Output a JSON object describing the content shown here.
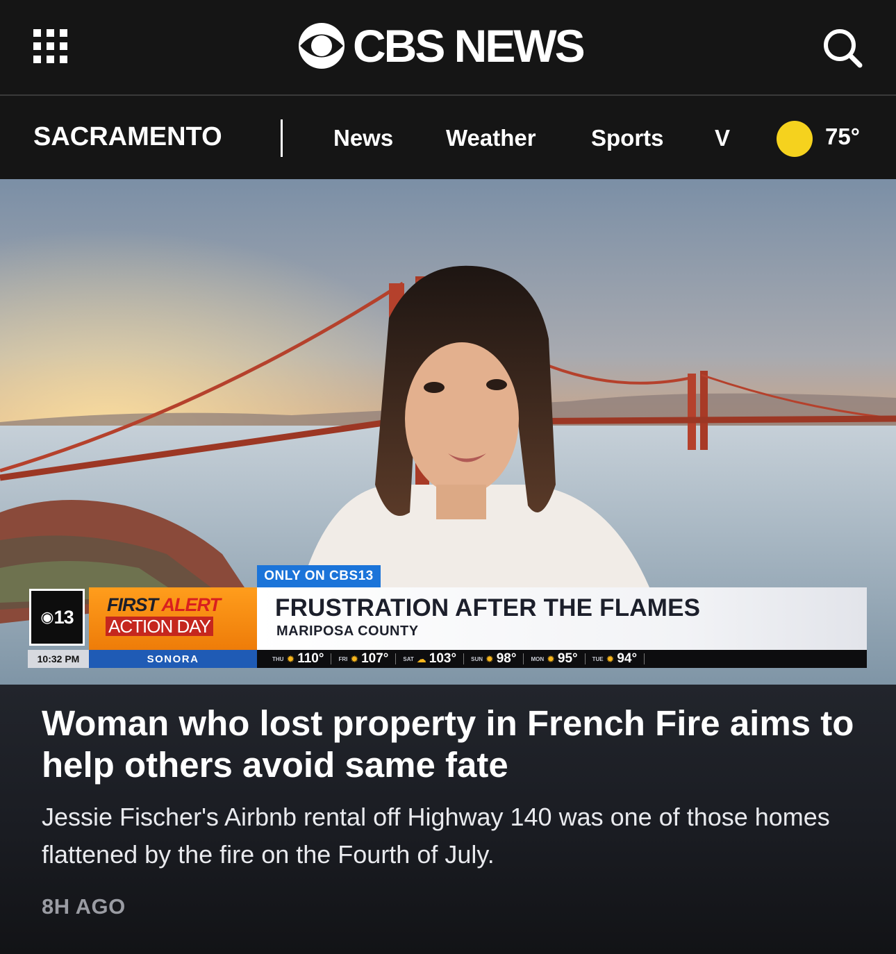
{
  "header": {
    "brand": "CBS NEWS",
    "menu_icon": "grid-menu-icon",
    "search_icon": "search-icon"
  },
  "local_nav": {
    "city": "SACRAMENTO",
    "items": [
      {
        "label": "News"
      },
      {
        "label": "Weather"
      },
      {
        "label": "Sports"
      },
      {
        "label": "V"
      }
    ],
    "weather_icon": "sun-icon",
    "temperature": "75°"
  },
  "video": {
    "badge": "ONLY ON CBS13",
    "station_logo": "13",
    "first_alert": {
      "first": "FIRST",
      "alert": "ALERT",
      "action_day": "ACTION DAY"
    },
    "headline": "FRUSTRATION AFTER THE FLAMES",
    "location": "MARIPOSA COUNTY",
    "time": "10:32 PM",
    "city": "SONORA",
    "forecast": [
      {
        "day": "THU",
        "icon": "sun-icon",
        "temp": "110°"
      },
      {
        "day": "FRI",
        "icon": "sun-icon",
        "temp": "107°"
      },
      {
        "day": "SAT",
        "icon": "partly-cloudy-icon",
        "temp": "103°"
      },
      {
        "day": "SUN",
        "icon": "sun-icon",
        "temp": "98°"
      },
      {
        "day": "MON",
        "icon": "sun-icon",
        "temp": "95°"
      },
      {
        "day": "TUE",
        "icon": "sun-icon",
        "temp": "94°"
      }
    ]
  },
  "article": {
    "headline": "Woman who lost property in French Fire aims to help others avoid same fate",
    "dek": "Jessie Fischer's Airbnb rental off Highway 140 was one of those homes flattened by the fire on the Fourth of July.",
    "time_ago": "8H AGO"
  },
  "colors": {
    "background": "#151515",
    "accent_yellow": "#f5d21e",
    "badge_blue": "#1b74d9",
    "alert_orange": "#f18a10",
    "alert_red": "#d91f1f"
  }
}
